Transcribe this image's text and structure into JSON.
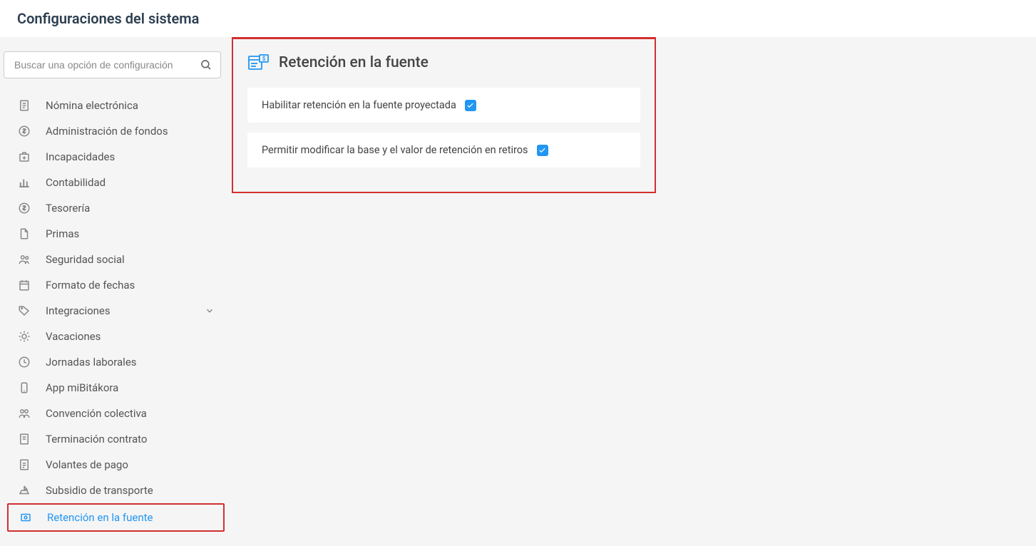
{
  "page_title": "Configuraciones del sistema",
  "search": {
    "placeholder": "Buscar una opción de configuración"
  },
  "sidebar": {
    "items": [
      {
        "label": "Nómina electrónica",
        "icon": "receipt"
      },
      {
        "label": "Administración de fondos",
        "icon": "dollar-circle"
      },
      {
        "label": "Incapacidades",
        "icon": "medkit"
      },
      {
        "label": "Contabilidad",
        "icon": "bar-chart"
      },
      {
        "label": "Tesorería",
        "icon": "dollar-circle"
      },
      {
        "label": "Primas",
        "icon": "document"
      },
      {
        "label": "Seguridad social",
        "icon": "people"
      },
      {
        "label": "Formato de fechas",
        "icon": "calendar"
      },
      {
        "label": "Integraciones",
        "icon": "tag",
        "expandable": true
      },
      {
        "label": "Vacaciones",
        "icon": "sun"
      },
      {
        "label": "Jornadas laborales",
        "icon": "clock"
      },
      {
        "label": "App miBitákora",
        "icon": "phone"
      },
      {
        "label": "Convención colectiva",
        "icon": "group"
      },
      {
        "label": "Terminación contrato",
        "icon": "contract"
      },
      {
        "label": "Volantes de pago",
        "icon": "payslip"
      },
      {
        "label": "Subsidio de transporte",
        "icon": "boat"
      },
      {
        "label": "Retención en la fuente",
        "icon": "money-doc",
        "active": true
      }
    ]
  },
  "main": {
    "title": "Retención en la fuente",
    "options": [
      {
        "label": "Habilitar retención en la fuente proyectada",
        "checked": true
      },
      {
        "label": "Permitir modificar la base y el valor de retención en retiros",
        "checked": true
      }
    ]
  }
}
